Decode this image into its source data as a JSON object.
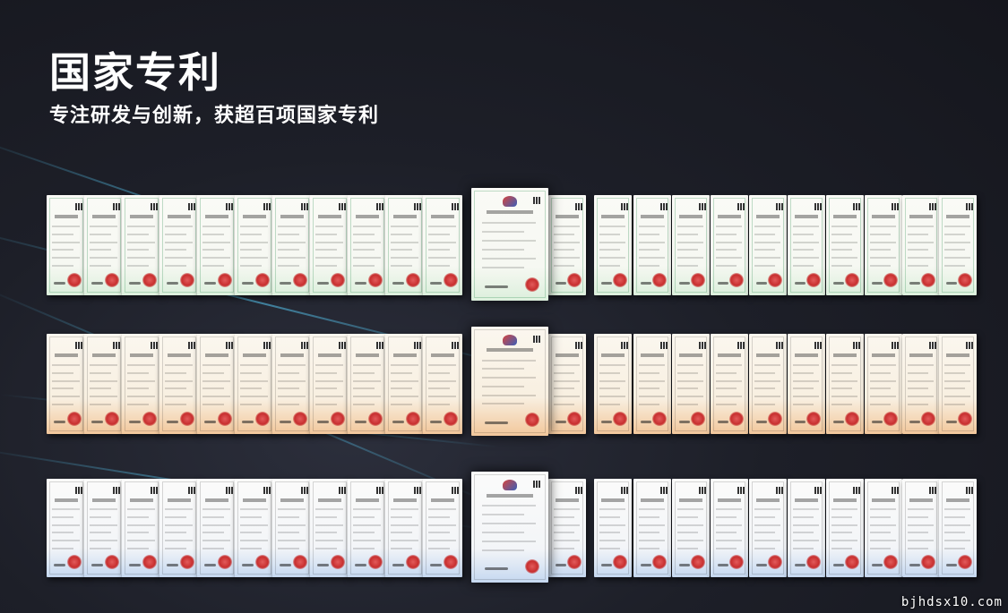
{
  "header": {
    "title": "国家专利",
    "subtitle": "专注研发与创新，获超百项国家专利"
  },
  "watermark": "bjhdsx10.com",
  "rows": [
    {
      "name": "utility-model-patents",
      "theme": "green"
    },
    {
      "name": "invention-patents",
      "theme": "orange"
    },
    {
      "name": "design-patents",
      "theme": "blue"
    }
  ],
  "colors": {
    "background": "#1d1f28",
    "text": "#ffffff",
    "accent_streak": "#5ad2ff"
  }
}
